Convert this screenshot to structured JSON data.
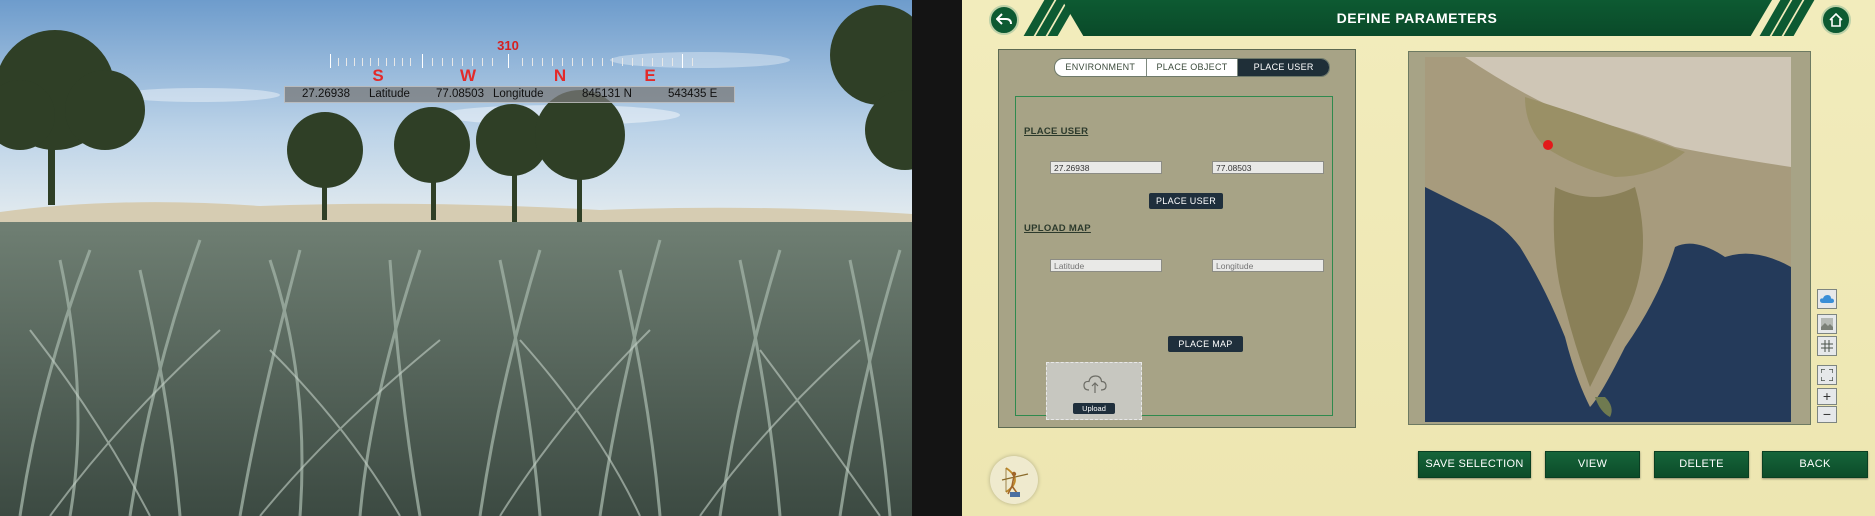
{
  "viewport": {
    "compass": {
      "heading": "310",
      "directions": [
        "S",
        "W",
        "N",
        "E"
      ]
    },
    "coords": {
      "latitude_value": "27.26938",
      "latitude_label": "Latitude",
      "longitude_value": "77.08503",
      "longitude_label": "Longitude",
      "northing": "845131 N",
      "easting": "543435 E"
    }
  },
  "header": {
    "title": "DEFINE PARAMETERS",
    "back_icon": "back-arrow-icon",
    "home_icon": "home-icon"
  },
  "tabs": [
    {
      "label": "ENVIRONMENT",
      "active": false
    },
    {
      "label": "PLACE OBJECT",
      "active": false
    },
    {
      "label": "PLACE USER",
      "active": true
    }
  ],
  "place_user": {
    "section_label": "PLACE USER",
    "latitude_value": "27.26938",
    "longitude_value": "77.08503",
    "button_label": "PLACE USER"
  },
  "upload_map": {
    "section_label": "UPLOAD MAP",
    "latitude_placeholder": "Latitude",
    "longitude_placeholder": "Longitude",
    "upload_label": "Upload",
    "button_label": "PLACE MAP"
  },
  "map_tools": [
    "cloud-layer-icon",
    "terrain-layer-icon",
    "grid-icon",
    "fullscreen-icon",
    "zoom-in-icon",
    "zoom-out-icon"
  ],
  "map_tool_glyphs": {
    "zoom_in": "+",
    "zoom_out": "−"
  },
  "colors": {
    "accent_green": "#0d5a32",
    "marker_red": "#e31a1a",
    "compass_red": "#e32a2a"
  },
  "footer": {
    "save_label": "SAVE SELECTION",
    "view_label": "VIEW",
    "delete_label": "DELETE",
    "back_label": "BACK"
  }
}
